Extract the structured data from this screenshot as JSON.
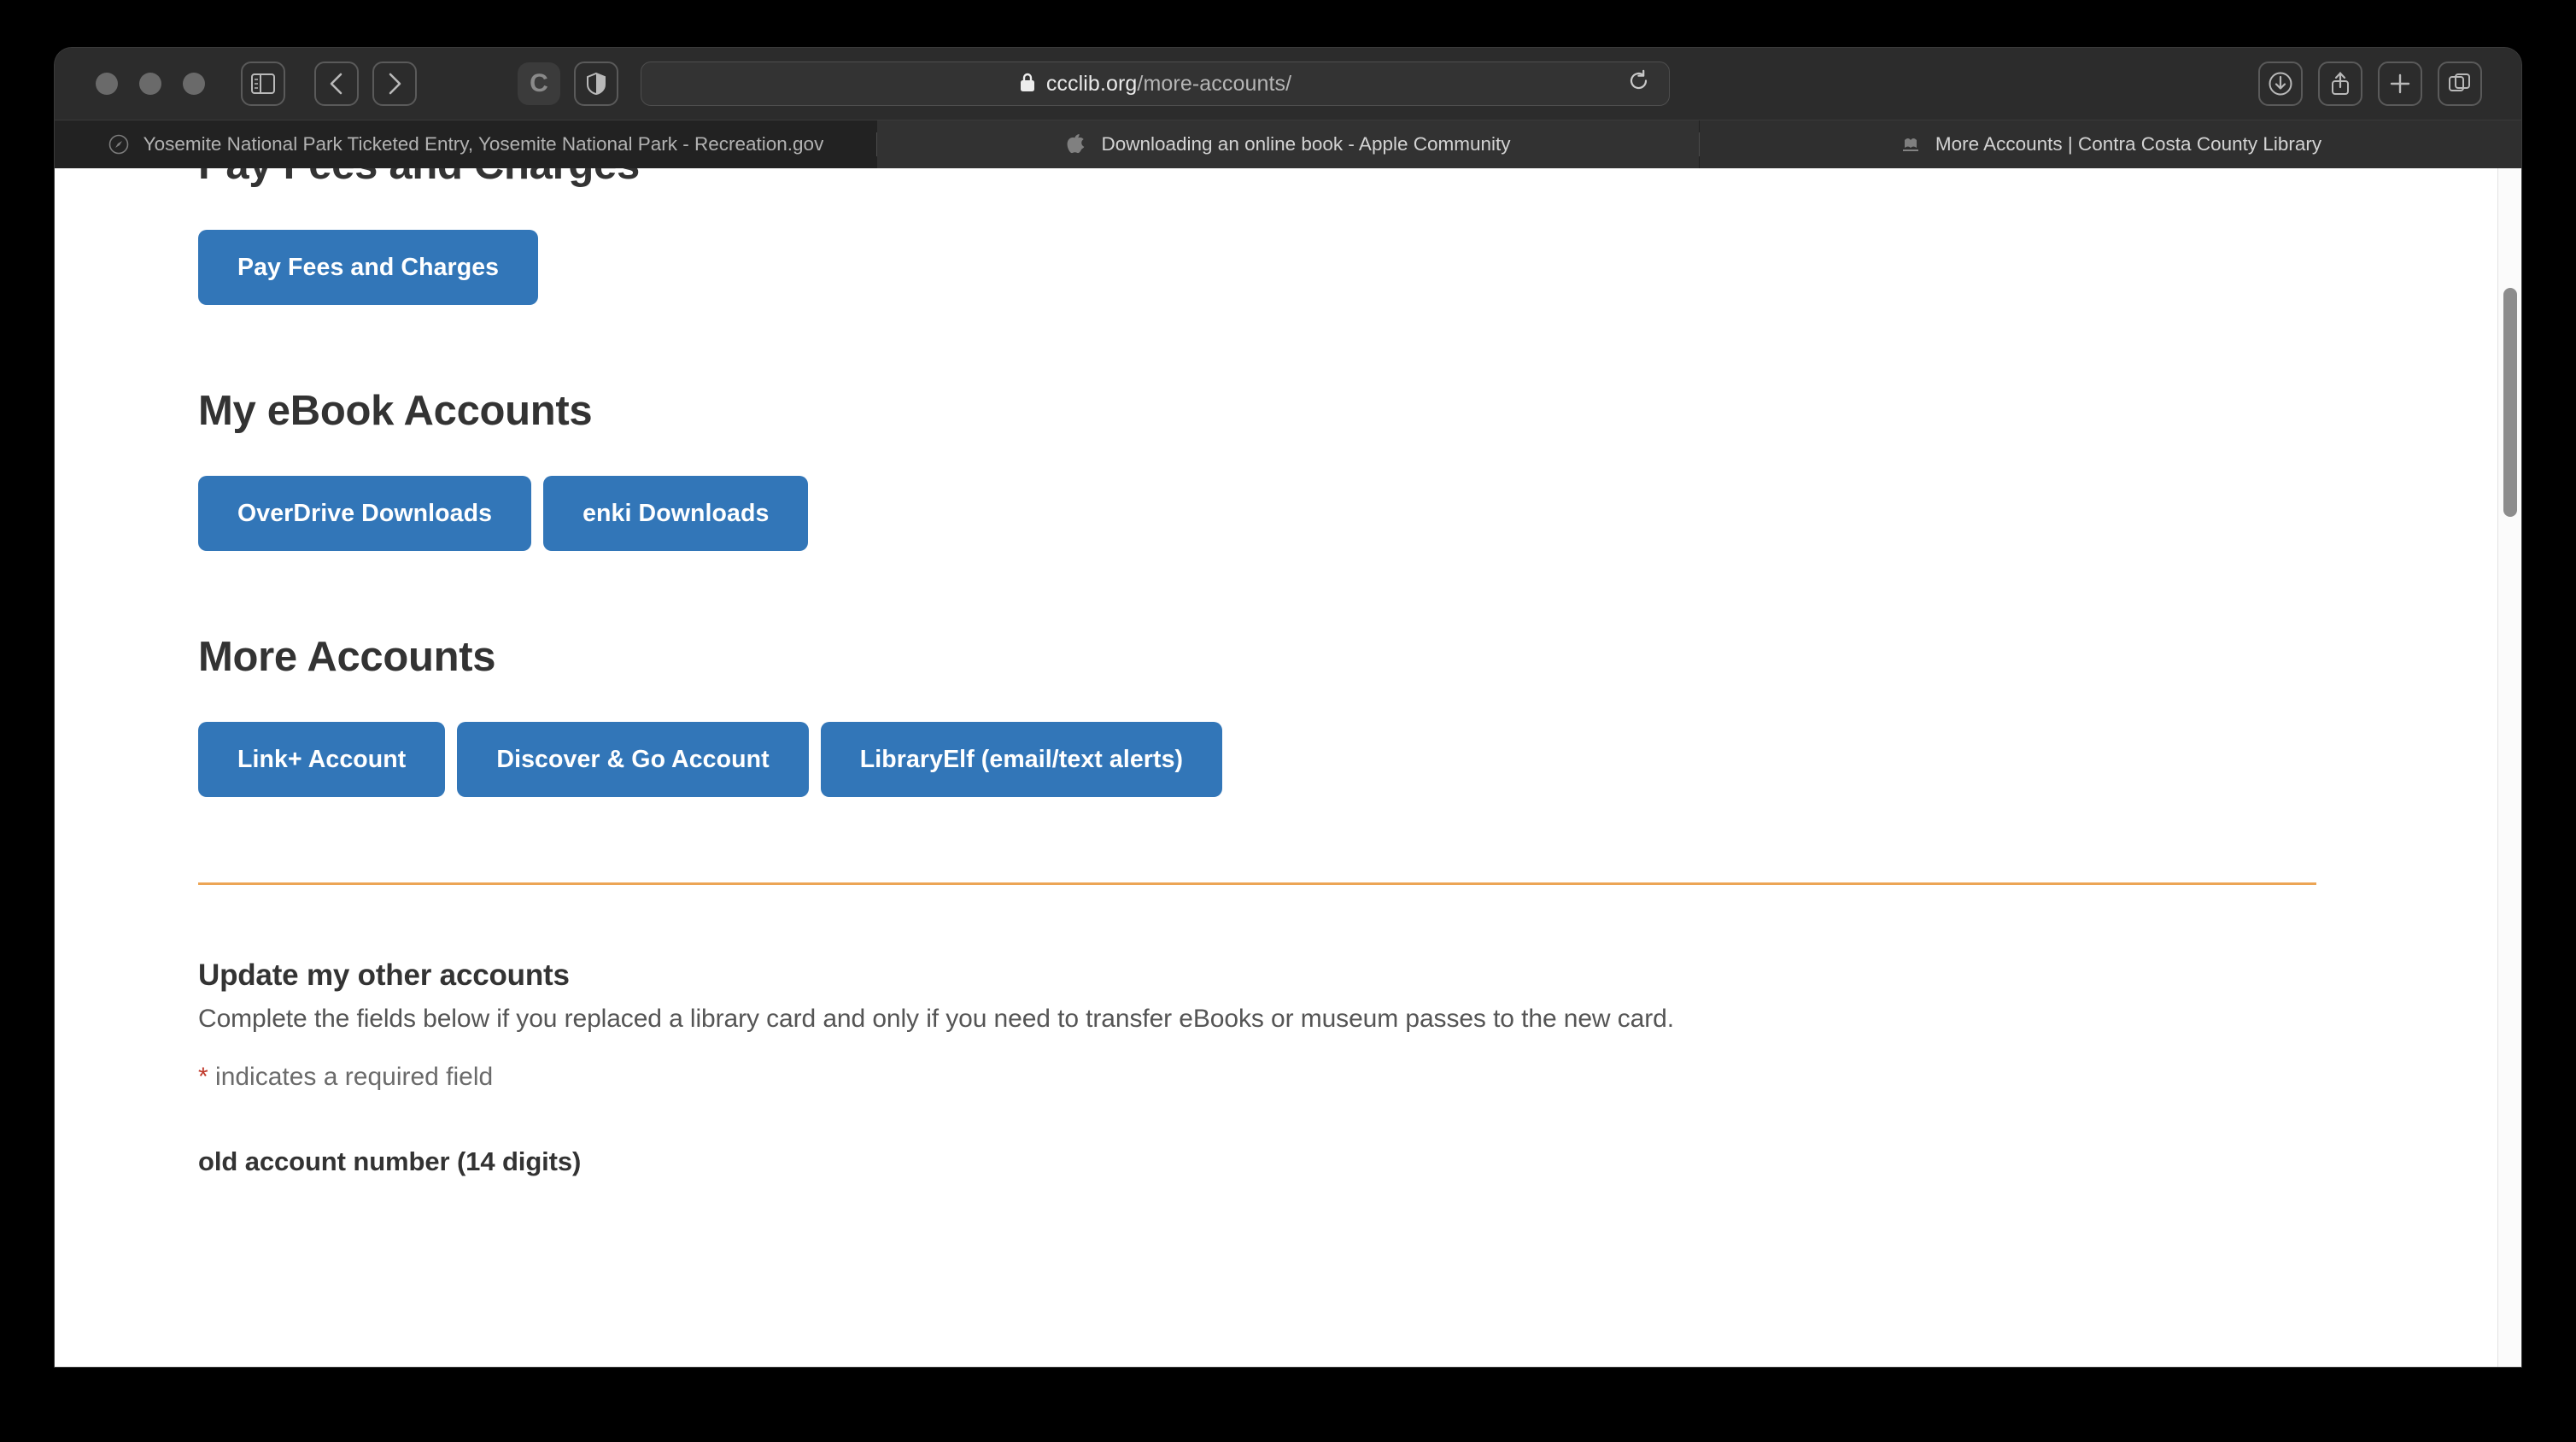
{
  "browser": {
    "window_controls": [
      "close",
      "minimize",
      "zoom"
    ],
    "sidebar_icon": "sidebar-icon",
    "back_icon": "chevron-left-icon",
    "forward_icon": "chevron-right-icon",
    "extension_icon_label": "C",
    "shield_icon": "privacy-shield-icon",
    "downloads_icon": "download-icon",
    "share_icon": "share-icon",
    "new_tab_icon": "plus-icon",
    "tab_overview_icon": "tab-overview-icon",
    "reload_icon": "reload-icon",
    "lock_icon": "lock-icon",
    "address": {
      "domain": "ccclib.org",
      "path": "/more-accounts/",
      "full": "ccclib.org/more-accounts/"
    },
    "tabs": [
      {
        "label": "Yosemite National Park Ticketed Entry, Yosemite National Park - Recreation.gov",
        "favicon": "compass-icon",
        "active": false
      },
      {
        "label": "Downloading an online book - Apple Community",
        "favicon": "apple-icon",
        "active": false
      },
      {
        "label": "More Accounts | Contra Costa County Library",
        "favicon": "library-icon",
        "active": true
      }
    ]
  },
  "page": {
    "clipped_heading": "Pay Fees and Charges",
    "sections": [
      {
        "heading": "Pay Fees and Charges",
        "buttons": [
          "Pay Fees and Charges"
        ]
      },
      {
        "heading": "My eBook Accounts",
        "buttons": [
          "OverDrive Downloads",
          "enki Downloads"
        ]
      },
      {
        "heading": "More Accounts",
        "buttons": [
          "Link+ Account",
          "Discover & Go Account",
          "LibraryElf (email/text alerts)"
        ]
      }
    ],
    "pay_button": "Pay Fees and Charges",
    "ebook_heading": "My eBook Accounts",
    "ebook_buttons": [
      "OverDrive Downloads",
      "enki Downloads"
    ],
    "more_heading": "More Accounts",
    "more_buttons": [
      "Link+ Account",
      "Discover & Go Account",
      "LibraryElf (email/text alerts)"
    ],
    "form": {
      "heading": "Update my other accounts",
      "description": "Complete the fields below if you replaced a library card and only if you need to transfer eBooks or museum passes to the new card.",
      "required_star": "*",
      "required_note": " indicates a required field",
      "first_field_label": "old account number (14 digits)"
    }
  },
  "colors": {
    "button_blue": "#3276b8",
    "divider_orange": "#eca555",
    "heading_gray": "#333333",
    "required_red": "#c0392b",
    "chrome_dark": "#2c2c2c",
    "tabbar_dark": "#222222"
  },
  "scrollbar": {
    "name": "vertical-scrollbar",
    "thumb_name": "scrollbar-thumb"
  }
}
